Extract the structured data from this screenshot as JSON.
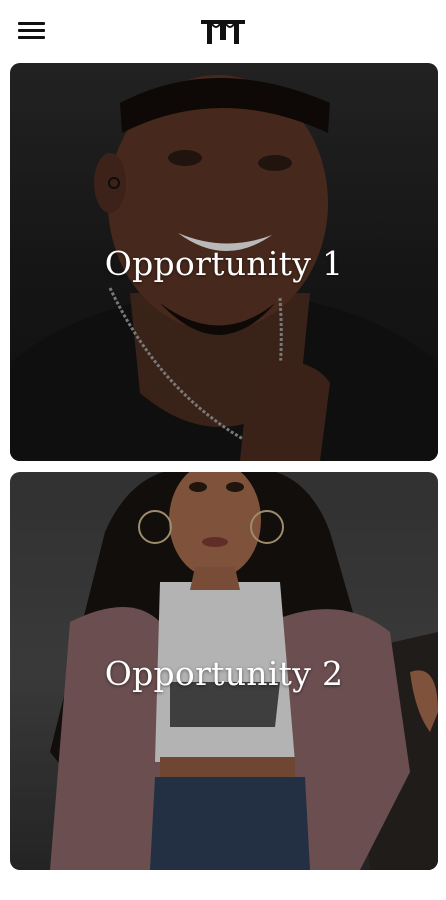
{
  "header": {
    "menu_icon": "hamburger-menu-icon",
    "logo_icon": "brand-m-logo-icon"
  },
  "cards": [
    {
      "title": "Opportunity 1"
    },
    {
      "title": "Opportunity 2"
    }
  ]
}
